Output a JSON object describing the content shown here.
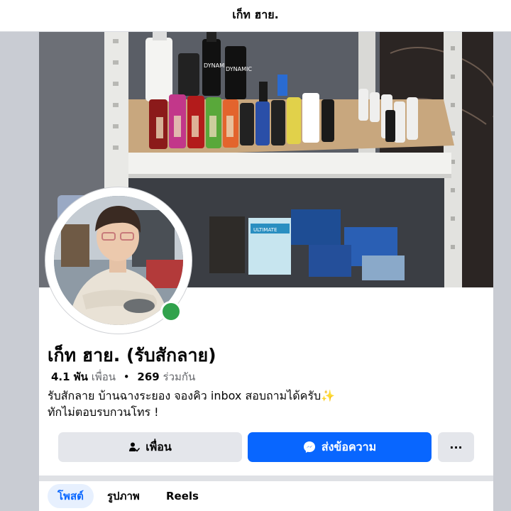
{
  "header": {
    "title": "เก็ท ฮาย."
  },
  "profile": {
    "name": "เก็ท ฮาย. (รับสักลาย)",
    "friends_count": "4.1 พัน",
    "friends_label": "เพื่อน",
    "separator": "•",
    "mutual_count": "269",
    "mutual_label": "ร่วมกัน",
    "bio_line1": "รับสักลาย บ้านฉางระยอง จองคิว inbox สอบถามได้ครับ✨",
    "bio_line2": "ทักไม่ตอบรบกวนโทร !",
    "online_color": "#31a24c"
  },
  "actions": {
    "friend_label": "เพื่อน",
    "message_label": "ส่งข้อความ",
    "more_label": "···",
    "message_color": "#0866ff"
  },
  "cover_photo": {
    "bottle_label": "DYNAMIC",
    "box_label": "ULTIMATE"
  },
  "tabs": [
    {
      "label": "โพสต์",
      "active": true
    },
    {
      "label": "รูปภาพ",
      "active": false
    },
    {
      "label": "Reels",
      "active": false
    }
  ],
  "icons": [
    "person-check-icon",
    "messenger-icon",
    "more-icon"
  ]
}
